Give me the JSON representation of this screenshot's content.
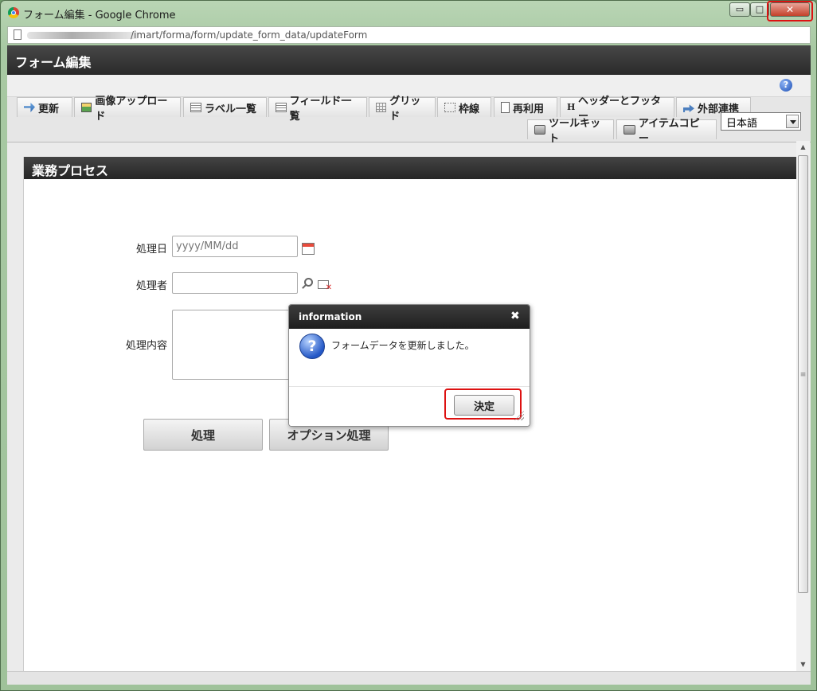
{
  "window": {
    "title": "フォーム編集 - Google Chrome",
    "minimize_glyph": "▭",
    "maximize_glyph": "□",
    "close_glyph": "✕"
  },
  "addressbar": {
    "url": "/imart/forma/form/update_form_data/updateForm"
  },
  "app": {
    "title": "フォーム編集",
    "help_glyph": "?"
  },
  "toolbar": {
    "tabs": [
      {
        "label": "更新",
        "icon": "refresh-arrow-icon"
      },
      {
        "label": "画像アップロード",
        "icon": "image-upload-icon"
      },
      {
        "label": "ラベル一覧",
        "icon": "list-icon"
      },
      {
        "label": "フィールド一覧",
        "icon": "list-icon"
      },
      {
        "label": "グリッド",
        "icon": "grid-icon"
      },
      {
        "label": "枠線",
        "icon": "border-icon"
      },
      {
        "label": "再利用",
        "icon": "copy-icon"
      },
      {
        "label": "ヘッダーとフッター",
        "icon": "header-icon",
        "glyph": "H"
      },
      {
        "label": "外部連携",
        "icon": "share-icon"
      },
      {
        "label": "ツールキット",
        "icon": "toolbox-icon"
      },
      {
        "label": "アイテムコピー",
        "icon": "toolbox-icon"
      }
    ],
    "language": "日本語"
  },
  "form": {
    "section_title": "業務プロセス",
    "fields": {
      "date_label": "処理日",
      "date_placeholder": "yyyy/MM/dd",
      "user_label": "処理者",
      "user_value": "",
      "content_label": "処理内容",
      "content_value": ""
    },
    "buttons": {
      "process": "処理",
      "option_process": "オプション処理"
    }
  },
  "dialog": {
    "title": "information",
    "close_glyph": "✖",
    "icon_glyph": "?",
    "message": "フォームデータを更新しました。",
    "ok_label": "決定"
  },
  "scrollbar": {
    "up_glyph": "▲",
    "down_glyph": "▼",
    "thumb_glyph": "≡"
  },
  "colors": {
    "highlight": "#dd1111",
    "header_dark": "#2a2a2a",
    "window_frame": "#a8c9a3"
  }
}
